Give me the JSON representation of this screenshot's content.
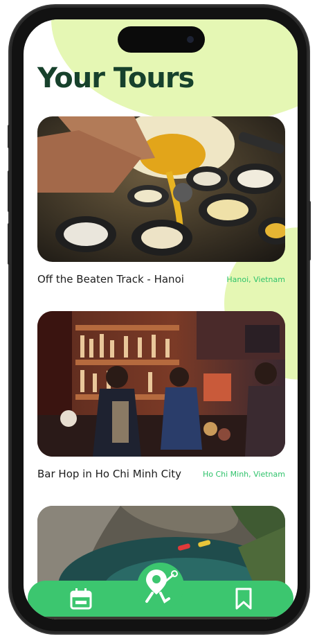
{
  "page": {
    "title": "Your Tours"
  },
  "tours": [
    {
      "name": "Off the Beaten Track - Hanoi",
      "location": "Hanoi, Vietnam",
      "image": "street-food-cooking-photo"
    },
    {
      "name": "Bar Hop in Ho Chi Minh City",
      "location": "Ho Chi Minh, Vietnam",
      "image": "bar-interior-photo"
    },
    {
      "name": "",
      "location": "",
      "image": "cenote-kayak-photo"
    }
  ],
  "nav": {
    "items": [
      {
        "icon": "calendar-icon"
      },
      {
        "icon": "tour-guide-logo-icon"
      },
      {
        "icon": "bookmark-icon"
      }
    ]
  },
  "colors": {
    "accent_green": "#3cc66f",
    "title_green": "#17412c",
    "location_green": "#2ec26a",
    "blob_lime": "#e5f7b4"
  }
}
